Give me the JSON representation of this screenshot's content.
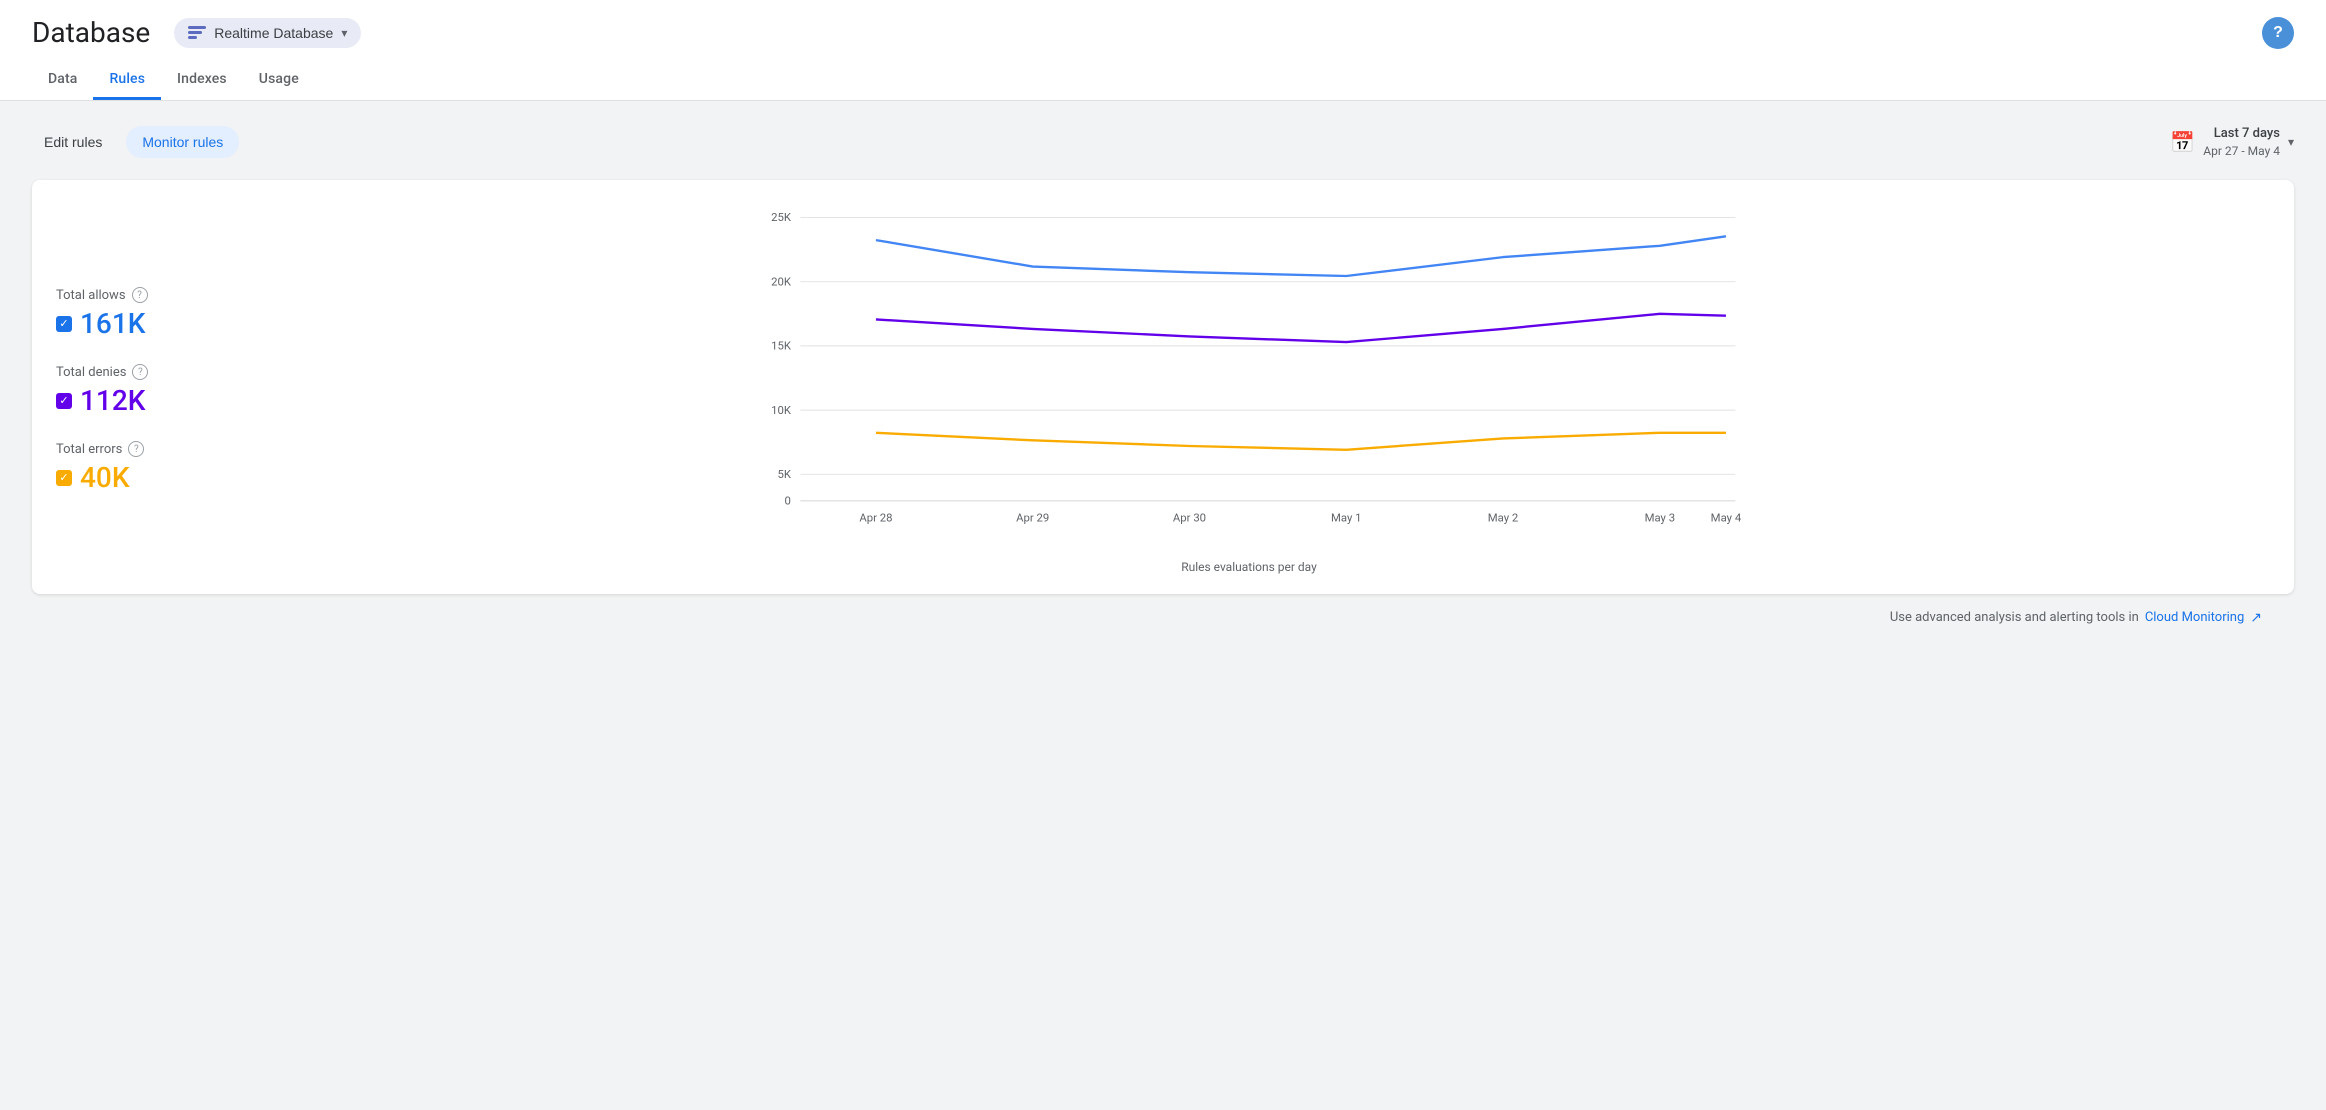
{
  "header": {
    "title": "Database",
    "db_selector_label": "Realtime Database",
    "help_label": "?"
  },
  "nav": {
    "tabs": [
      {
        "id": "data",
        "label": "Data",
        "active": false
      },
      {
        "id": "rules",
        "label": "Rules",
        "active": true
      },
      {
        "id": "indexes",
        "label": "Indexes",
        "active": false
      },
      {
        "id": "usage",
        "label": "Usage",
        "active": false
      }
    ]
  },
  "toolbar": {
    "edit_rules_label": "Edit rules",
    "monitor_rules_label": "Monitor rules",
    "date_range_title": "Last 7 days",
    "date_range_sub": "Apr 27 - May 4"
  },
  "chart": {
    "metrics": [
      {
        "id": "allows",
        "label": "Total allows",
        "value": "161K",
        "color_class": "blue",
        "checkbox_color": "blue",
        "color_hex": "#4285f4"
      },
      {
        "id": "denies",
        "label": "Total denies",
        "value": "112K",
        "color_class": "purple",
        "checkbox_color": "purple",
        "color_hex": "#6200ea"
      },
      {
        "id": "errors",
        "label": "Total errors",
        "value": "40K",
        "color_class": "yellow",
        "checkbox_color": "yellow",
        "color_hex": "#f9ab00"
      }
    ],
    "y_axis_labels": [
      "0",
      "5K",
      "10K",
      "15K",
      "20K",
      "25K"
    ],
    "x_axis_labels": [
      "Apr 28",
      "Apr 29",
      "Apr 30",
      "May 1",
      "May 2",
      "May 3",
      "May 4"
    ],
    "x_label": "Rules evaluations per day"
  },
  "footer": {
    "note_text": "Use advanced analysis and alerting tools in",
    "link_text": "Cloud Monitoring",
    "external_link_icon": "↗"
  }
}
